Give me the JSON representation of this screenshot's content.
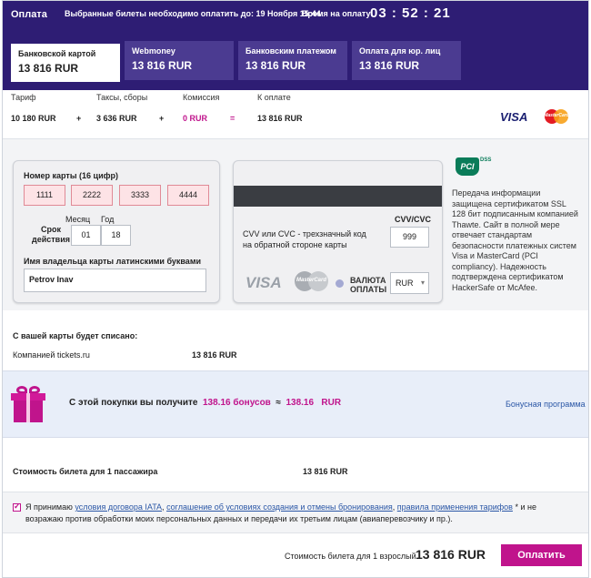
{
  "header": {
    "title": "Оплата",
    "notice": "Выбранные билеты необходимо оплатить до: 19 Ноября 15:44",
    "time_label": "Время на оплату:",
    "timer": "03 : 52 : 21"
  },
  "tabs": [
    {
      "name": "Банковской картой",
      "price": "13 816 RUR"
    },
    {
      "name": "Webmoney",
      "price": "13 816 RUR"
    },
    {
      "name": "Банковским платежом",
      "price": "13 816 RUR"
    },
    {
      "name": "Оплата для юр. лиц",
      "price": "13 816 RUR"
    }
  ],
  "sum": {
    "tariff_label": "Тариф",
    "tariff_value": "10 180 RUR",
    "plus1": "+",
    "taxes_label": "Таксы, сборы",
    "taxes_value": "3 636 RUR",
    "plus2": "+",
    "fee_label": "Комиссия",
    "fee_value": "0 RUR",
    "eq": "=",
    "total_label": "К оплате",
    "total_value": "13 816 RUR",
    "visa": "VISA",
    "mastercard": "MasterCard"
  },
  "card": {
    "number_label": "Номер карты (16 цифр)",
    "number_parts": [
      "1111",
      "2222",
      "3333",
      "4444"
    ],
    "term_label_1": "Срок",
    "term_label_2": "действия",
    "month_label": "Месяц",
    "year_label": "Год",
    "month": "01",
    "year": "18",
    "holder_label": "Имя владельца карты латинскими буквами",
    "holder": "Petrov Inav",
    "cvv_title": "CVV/CVC",
    "cvv_text_1": "CVV или CVC - трехзначный код",
    "cvv_text_2": "на обратной стороне карты",
    "cvv": "999",
    "visa": "VISA",
    "mastercard": "MasterCard",
    "currency_label_1": "ВАЛЮТА",
    "currency_label_2": "ОПЛАТЫ",
    "currency": "RUR"
  },
  "pci": {
    "logo": "PCI",
    "dss": "DSS",
    "text": "Передача информации защищена сертификатом SSL 128 бит подписанным компанией Thawte. Сайт в полной мере отвечает стандартам безопасности платежных систем Visa и MasterCard (PCI compliancy). Надежность подтверждена сертификатом HackerSafe от McAfee."
  },
  "charge": {
    "title": "С вашей карты будет списано:",
    "row_label": "Компанией tickets.ru",
    "row_value": "13 816 RUR"
  },
  "bonus": {
    "text_prefix": "С этой покупки вы получите",
    "amount": "138.16 бонусов",
    "approx": "≈",
    "rub_amount": "138.16   RUR",
    "link": "Бонусная программа"
  },
  "ticket": {
    "label": "Стоимость билета для 1 пассажира",
    "value": "13 816 RUR"
  },
  "agreement": {
    "t1": "Я принимаю",
    "l1": "условия договора IATA",
    "t2": ",",
    "l2": "соглашение об условиях создания и отмены бронирования",
    "t3": ",",
    "l3": "правила применения тарифов",
    "t4": "* и не возражаю против обработки моих персональных данных и передачи их третьим лицам (авиаперевозчику и пр.)."
  },
  "footer": {
    "label": "Стоимость билета для 1 взрослый",
    "price": "13 816 RUR",
    "pay_button": "Оплатить"
  },
  "colors": {
    "header_bg": "#2e1d74",
    "tab_bg": "#4b3b91",
    "accent": "#c0148c",
    "link": "#2b57a6"
  }
}
